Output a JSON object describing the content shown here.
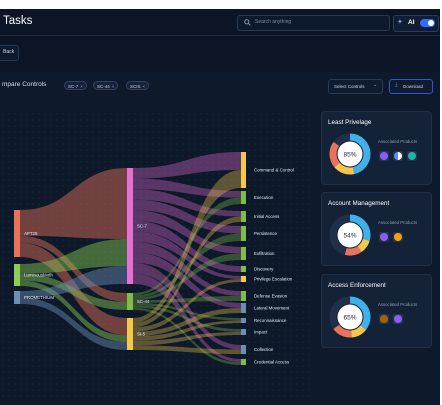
{
  "header": {
    "title": "Tasks",
    "search_placeholder": "Search anything",
    "ai_label": "AI",
    "ai_enabled": true
  },
  "toolbar": {
    "back_label": "Back"
  },
  "compare": {
    "title": "mpare Controls",
    "chips": [
      "SC-7",
      "SC-44",
      "SCIS"
    ],
    "select_label": "Select Controls",
    "download_label": "Download"
  },
  "sankey": {
    "sources": [
      {
        "id": "apt29",
        "label": "APT29",
        "color": "#e8735a"
      },
      {
        "id": "luminous",
        "label": "LuminousMoth",
        "color": "#8ccd55"
      },
      {
        "id": "promethium",
        "label": "PROMETHIUM",
        "color": "#6d8fb6"
      }
    ],
    "controls": [
      {
        "id": "sc7",
        "label": "SC-7",
        "color": "#e86fd8"
      },
      {
        "id": "sc44",
        "label": "SC-44",
        "color": "#7fbd4a"
      },
      {
        "id": "si5",
        "label": "SI-5",
        "color": "#f5c84c"
      }
    ],
    "tactics": [
      {
        "label": "Command & Control",
        "color": "#f5c84c"
      },
      {
        "label": "Execution",
        "color": "#7fbd4a"
      },
      {
        "label": "Initial Access",
        "color": "#7fbd4a"
      },
      {
        "label": "Persistence",
        "color": "#7fbd4a"
      },
      {
        "label": "Exfiltration",
        "color": "#7fbd4a"
      },
      {
        "label": "Discovery",
        "color": "#7fbd4a"
      },
      {
        "label": "Privilege Escalation",
        "color": "#f5c84c"
      },
      {
        "label": "Defense Evasion",
        "color": "#7fbd4a"
      },
      {
        "label": "Lateral Movement",
        "color": "#6d8fb6"
      },
      {
        "label": "Reconnaissance",
        "color": "#6d8fb6"
      },
      {
        "label": "Impact",
        "color": "#6d8fb6"
      },
      {
        "label": "Collection",
        "color": "#6d8fb6"
      },
      {
        "label": "Credential Access",
        "color": "#7fbd4a"
      }
    ]
  },
  "cards": [
    {
      "title": "Least Privelage",
      "percent": "85%",
      "fraction": 0.85,
      "associated_label": "Associated Products",
      "products": [
        "purple-shield-icon",
        "blue-split-icon",
        "teal-eyes-icon"
      ]
    },
    {
      "title": "Account Management",
      "percent": "54%",
      "fraction": 0.54,
      "associated_label": "Associated Products",
      "products": [
        "purple-shield-icon",
        "orange-badge-icon"
      ]
    },
    {
      "title": "Access Enforcement",
      "percent": "65%",
      "fraction": 0.65,
      "associated_label": "Associated Products",
      "products": [
        "brown-cube-icon",
        "purple-shield-icon"
      ]
    }
  ]
}
